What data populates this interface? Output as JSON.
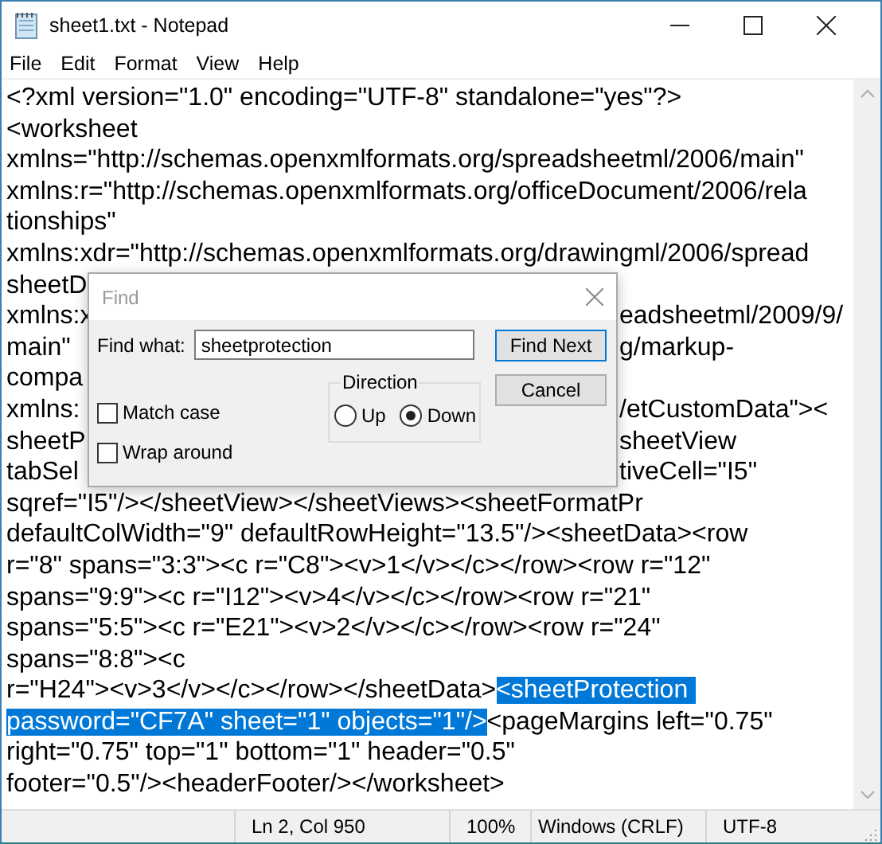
{
  "window": {
    "title": "sheet1.txt - Notepad"
  },
  "menu": [
    {
      "label": "File"
    },
    {
      "label": "Edit"
    },
    {
      "label": "Format"
    },
    {
      "label": "View"
    },
    {
      "label": "Help"
    }
  ],
  "editor": {
    "lines": [
      {
        "kind": "full",
        "segments": [
          {
            "text": "<?xml version=\"1.0\" encoding=\"UTF-8\" standalone=\"yes\"?>",
            "selected": false
          }
        ]
      },
      {
        "kind": "full",
        "segments": [
          {
            "text": "<worksheet",
            "selected": false
          }
        ]
      },
      {
        "kind": "full",
        "segments": [
          {
            "text": "xmlns=\"http://schemas.openxmlformats.org/spreadsheetml/2006/main\"",
            "selected": false
          }
        ]
      },
      {
        "kind": "full",
        "segments": [
          {
            "text": "xmlns:r=\"http://schemas.openxmlformats.org/officeDocument/2006/rela",
            "selected": false
          }
        ]
      },
      {
        "kind": "full",
        "segments": [
          {
            "text": "tionships\"",
            "selected": false
          }
        ]
      },
      {
        "kind": "full",
        "segments": [
          {
            "text": "xmlns:xdr=\"http://schemas.openxmlformats.org/drawingml/2006/spread",
            "selected": false
          }
        ]
      },
      {
        "kind": "covered",
        "segments": [
          {
            "text": "sheetD",
            "selected": false
          }
        ]
      },
      {
        "kind": "covered",
        "segments": [
          {
            "text": "xmlns:x",
            "selected": false
          },
          {
            "text": "eadsheetml/2009/9/",
            "selected": false
          }
        ]
      },
      {
        "kind": "covered",
        "segments": [
          {
            "text": "main\"",
            "selected": false
          },
          {
            "text": "g/markup-",
            "selected": false
          }
        ]
      },
      {
        "kind": "covered",
        "segments": [
          {
            "text": "compa",
            "selected": false
          }
        ]
      },
      {
        "kind": "covered",
        "segments": [
          {
            "text": "xmlns:",
            "selected": false
          },
          {
            "text": "/etCustomData\"><",
            "selected": false
          }
        ]
      },
      {
        "kind": "covered",
        "segments": [
          {
            "text": "sheetP",
            "selected": false
          },
          {
            "text": "sheetView",
            "selected": false
          }
        ]
      },
      {
        "kind": "covered",
        "segments": [
          {
            "text": "tabSel",
            "selected": false
          },
          {
            "text": "tiveCell=\"I5\"",
            "selected": false
          }
        ]
      },
      {
        "kind": "full",
        "segments": [
          {
            "text": "sqref=\"I5\"/></sheetView></sheetViews><sheetFormatPr",
            "selected": false
          }
        ]
      },
      {
        "kind": "full",
        "segments": [
          {
            "text": "defaultColWidth=\"9\" defaultRowHeight=\"13.5\"/><sheetData><row",
            "selected": false
          }
        ]
      },
      {
        "kind": "full",
        "segments": [
          {
            "text": "r=\"8\" spans=\"3:3\"><c r=\"C8\"><v>1</v></c></row><row r=\"12\"",
            "selected": false
          }
        ]
      },
      {
        "kind": "full",
        "segments": [
          {
            "text": "spans=\"9:9\"><c r=\"I12\"><v>4</v></c></row><row r=\"21\"",
            "selected": false
          }
        ]
      },
      {
        "kind": "full",
        "segments": [
          {
            "text": "spans=\"5:5\"><c r=\"E21\"><v>2</v></c></row><row r=\"24\"",
            "selected": false
          }
        ]
      },
      {
        "kind": "full",
        "segments": [
          {
            "text": "spans=\"8:8\"><c",
            "selected": false
          }
        ]
      },
      {
        "kind": "full",
        "segments": [
          {
            "text": "r=\"H24\"><v>3</v></c></row></sheetData>",
            "selected": false
          },
          {
            "text": "<sheetProtection ",
            "selected": true
          }
        ]
      },
      {
        "kind": "full",
        "segments": [
          {
            "text": "password=\"CF7A\" sheet=\"1\" objects=\"1\"/>",
            "selected": true
          },
          {
            "text": "<pageMargins left=\"0.75\"",
            "selected": false
          }
        ]
      },
      {
        "kind": "full",
        "segments": [
          {
            "text": "right=\"0.75\" top=\"1\" bottom=\"1\" header=\"0.5\"",
            "selected": false
          }
        ]
      },
      {
        "kind": "full",
        "segments": [
          {
            "text": "footer=\"0.5\"/><headerFooter/></worksheet>",
            "selected": false
          }
        ]
      }
    ]
  },
  "find_dialog": {
    "title": "Find",
    "find_what": {
      "label": "Find what:",
      "value": "sheetprotection"
    },
    "buttons": [
      {
        "label": "Find Next",
        "kind": "default"
      },
      {
        "label": "Cancel",
        "kind": "normal"
      }
    ],
    "checkboxes": [
      {
        "label": "Match case",
        "checked": false
      },
      {
        "label": "Wrap around",
        "checked": false
      }
    ],
    "direction": {
      "label": "Direction",
      "options": [
        {
          "label": "Up",
          "selected": false
        },
        {
          "label": "Down",
          "selected": true
        }
      ]
    }
  },
  "status_bar": [
    {
      "text": "Ln 2, Col 950"
    },
    {
      "text": "100%"
    },
    {
      "text": "Windows (CRLF)"
    },
    {
      "text": "UTF-8"
    }
  ]
}
